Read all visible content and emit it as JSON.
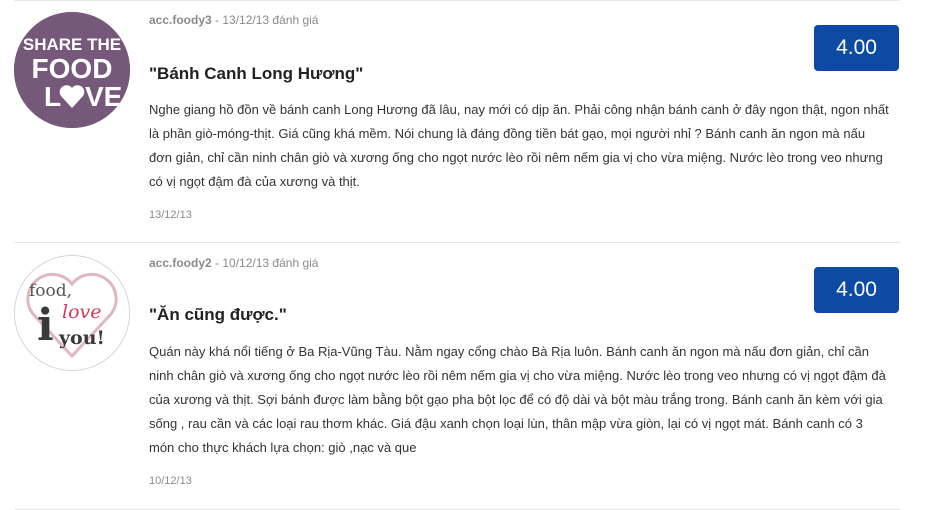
{
  "reviews": [
    {
      "user": "acc.foody3",
      "sep": " - ",
      "date_inline": "13/12/13",
      "action": " đánh giá",
      "score": "4.00",
      "title": "\"Bánh Canh Long Hương\"",
      "body": "Nghe giang hồ đồn về bánh canh Long Hương đã lâu, nay mới có dịp ăn. Phải công nhận bánh canh ở đây ngon thật, ngon nhất là phần giò-móng-thịt. Giá cũng khá mềm. Nói chung là đáng đồng tiền bát gạo, mọi người nhỉ ? Bánh canh ăn ngon mà nấu đơn giản, chỉ cần ninh chân giò và xương ống cho ngọt nước lèo rồi nêm nếm gia vị cho vừa miệng. Nước lèo trong veo nhưng có vị ngọt đậm đà của xương và thịt.",
      "date": "13/12/13",
      "avatar": {
        "line1": "SHARE THE",
        "line2": "FOOD",
        "line3": "LOVE",
        "bg": "#76587a"
      }
    },
    {
      "user": "acc.foody2",
      "sep": " - ",
      "date_inline": "10/12/13",
      "action": " đánh giá",
      "score": "4.00",
      "title": "\"Ăn cũng được.\"",
      "body": "Quán này khá nổi tiếng ở Ba Rịa-Vũng Tàu. Nằm ngay cổng chào Bà Rịa luôn. Bánh canh ăn ngon mà nấu đơn giản, chỉ cần ninh chân giò và xương ống cho ngọt nước lèo rồi nêm nếm gia vị cho vừa miệng. Nước lèo trong veo nhưng có vị ngọt đậm đà của xương và thịt. Sợi bánh được làm bằng bột gạo pha bột lọc để có độ dài và bột màu trắng trong. Bánh canh ăn kèm với gia sống , rau cần và các loại rau thơm khác. Giá đậu xanh chọn loại lùn, thân mập vừa giòn, lại có vị ngọt mát. Bánh canh có 3 món cho thực khách lựa chọn: giò ,nạc và que",
      "date": "10/12/13",
      "avatar": {
        "line1": "food,",
        "line2": "love",
        "line3": "you!",
        "letter": "i"
      }
    }
  ],
  "colors": {
    "score_bg": "#0d4aa3",
    "meta": "#8a8a8a",
    "divider": "#e6e6e6"
  }
}
